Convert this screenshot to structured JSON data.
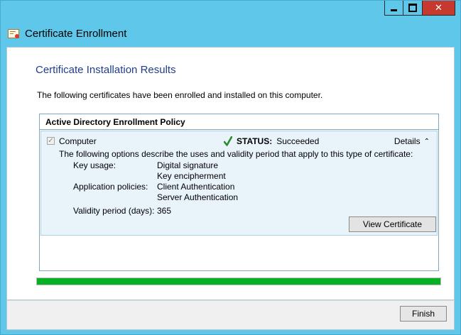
{
  "window": {
    "title": "Certificate Enrollment",
    "title_icon": "certificate-icon",
    "caption_buttons": [
      "minimize",
      "maximize",
      "close"
    ]
  },
  "page": {
    "heading": "Certificate Installation Results",
    "intro": "The following certificates have been enrolled and installed on this computer."
  },
  "policy": {
    "header": "Active Directory Enrollment Policy",
    "certificate": {
      "name": "Computer",
      "checked": true,
      "status_label": "STATUS:",
      "status_value": "Succeeded",
      "details_label": "Details",
      "description": "The following options describe the uses and validity period that apply to this type of certificate:",
      "key_usage_label": "Key usage:",
      "key_usage": [
        "Digital signature",
        "Key encipherment"
      ],
      "app_policies_label": "Application policies:",
      "app_policies": [
        "Client Authentication",
        "Server Authentication"
      ],
      "validity_label": "Validity period (days):",
      "validity_value": "365",
      "view_button": "View Certificate"
    }
  },
  "progress": {
    "value": 1.0,
    "color": "#06b025"
  },
  "footer": {
    "finish_button": "Finish"
  },
  "colors": {
    "titlebar": "#5fc7ea",
    "heading": "#1e3e8c",
    "close": "#c7382f"
  }
}
